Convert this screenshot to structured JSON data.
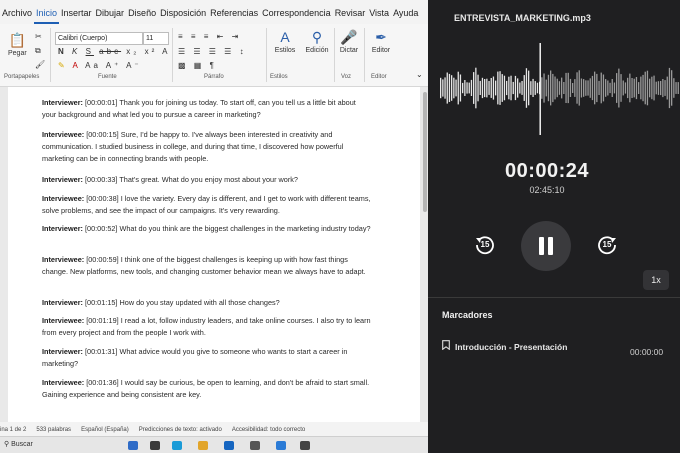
{
  "menu": [
    "Archivo",
    "Inicio",
    "Insertar",
    "Dibujar",
    "Diseño",
    "Disposición",
    "Referencias",
    "Correspondencia",
    "Revisar",
    "Vista",
    "Ayuda"
  ],
  "menu_active": "Inicio",
  "ribbon": {
    "paste_label": "Pegar",
    "font_name": "Calibri (Cuerpo)",
    "font_size": "11",
    "styles_label": "Estilos",
    "editing_label": "Edición",
    "dictate_label": "Dictar",
    "editor_label": "Editor",
    "group_labels": [
      "Portapapeles",
      "Fuente",
      "Párrafo",
      "Estilos",
      "Voz",
      "Editor"
    ]
  },
  "document": {
    "paragraphs": [
      {
        "speaker": "Interviewer:",
        "text": "[00:00:01] Thank you for joining us today. To start off, can you tell us a little bit about your background and what led you to pursue a career in marketing?"
      },
      {
        "speaker": "Interviewee:",
        "text": "[00:00:15] Sure, I'd be happy to. I've always been interested in creativity and communication. I studied business in college, and during that time, I discovered how powerful marketing can be in connecting brands with people."
      },
      {
        "speaker": "Interviewer:",
        "text": "[00:00:33] That's great. What do you enjoy most about your work?"
      },
      {
        "speaker": "Interviewee:",
        "text": "[00:00:38] I love the variety. Every day is different, and I get to work with different teams, solve problems, and see the impact of our campaigns. It's very rewarding."
      },
      {
        "speaker": "Interviewer:",
        "text": "[00:00:52] What do you think are the biggest challenges in the marketing industry today?"
      },
      {
        "speaker": "Interviewee:",
        "text": "[00:00:59] I think one of the biggest challenges is keeping up with how fast things change. New platforms, new tools, and changing customer behavior mean we always have to adapt."
      },
      {
        "speaker": "Interviewer:",
        "text": "[00:01:15] How do you stay updated with all those changes?"
      },
      {
        "speaker": "Interviewee:",
        "text": "[00:01:19] I read a lot, follow industry leaders, and take online courses. I also try to learn from every project and from the people I work with."
      },
      {
        "speaker": "Interviewer:",
        "text": "[00:01:31] What advice would you give to someone who wants to start a career in marketing?"
      },
      {
        "speaker": "Interviewee:",
        "text": "[00:01:36] I would say be curious, be open to learning, and don't be afraid to start small. Gaining experience and being consistent are key."
      }
    ]
  },
  "status": {
    "page": "ina 1 de 2",
    "words": "533 palabras",
    "language": "Español (España)",
    "predictions": "Predicciones de texto: activado",
    "accessibility": "Accesibilidad: todo correcto"
  },
  "taskbar": {
    "search": "Buscar"
  },
  "player": {
    "file_name": "ENTREVISTA_MARKETING.mp3",
    "current_time": "00:00:24",
    "duration": "02:45:10",
    "skip_back_seconds": "15",
    "skip_forward_seconds": "15",
    "speed": "1x",
    "bookmarks_header": "Marcadores",
    "bookmarks": [
      {
        "label": "Introducción - Presentación",
        "time": "00:00:00"
      }
    ]
  },
  "colors": {
    "word_accent": "#1e5fb4",
    "player_bg": "#1f1f21"
  }
}
